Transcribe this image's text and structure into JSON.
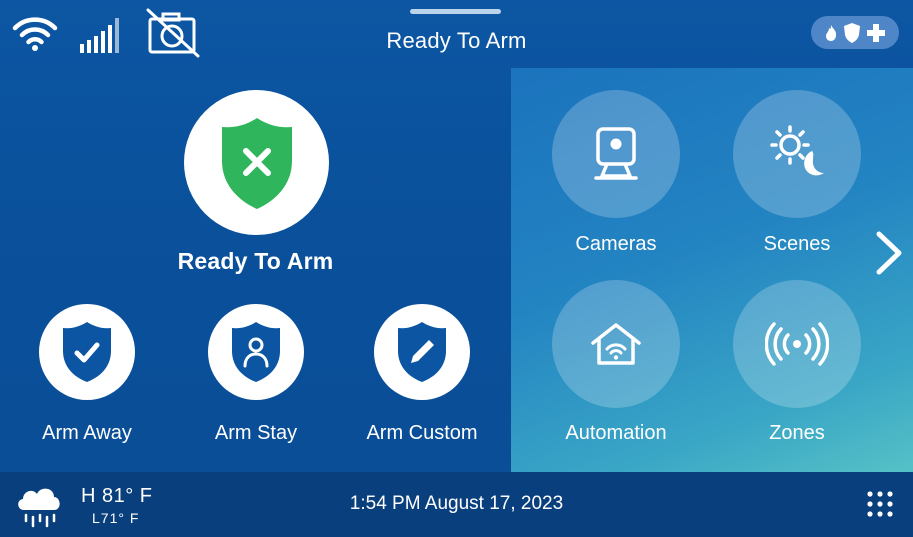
{
  "status_bar": {
    "title": "Ready To Arm",
    "icons": [
      "wifi-icon",
      "cellular-signal-icon",
      "camera-off-icon"
    ],
    "emergency_icons": [
      "fire-icon",
      "police-shield-icon",
      "medical-cross-icon"
    ]
  },
  "arm_panel": {
    "status_label": "Ready To Arm",
    "status_icon": "shield-x-icon",
    "modes": [
      {
        "label": "Arm Away",
        "icon": "shield-check-icon"
      },
      {
        "label": "Arm Stay",
        "icon": "shield-person-icon"
      },
      {
        "label": "Arm Custom",
        "icon": "shield-pencil-icon"
      }
    ]
  },
  "shortcuts": [
    {
      "label": "Cameras",
      "icon": "camera-icon"
    },
    {
      "label": "Scenes",
      "icon": "sun-moon-icon"
    },
    {
      "label": "Automation",
      "icon": "smart-home-icon"
    },
    {
      "label": "Zones",
      "icon": "sensor-signal-icon"
    }
  ],
  "footer": {
    "weather_icon": "rain-cloud-icon",
    "temp_high": "H 81° F",
    "temp_low": "L71° F",
    "datetime": "1:54 PM August 17, 2023"
  },
  "colors": {
    "background": "#0b52a0",
    "ready_green": "#2fb55b",
    "shield_blue": "#0b55a3",
    "footer": "#0a3f7d",
    "emergency_pill": "#4f86c8"
  }
}
